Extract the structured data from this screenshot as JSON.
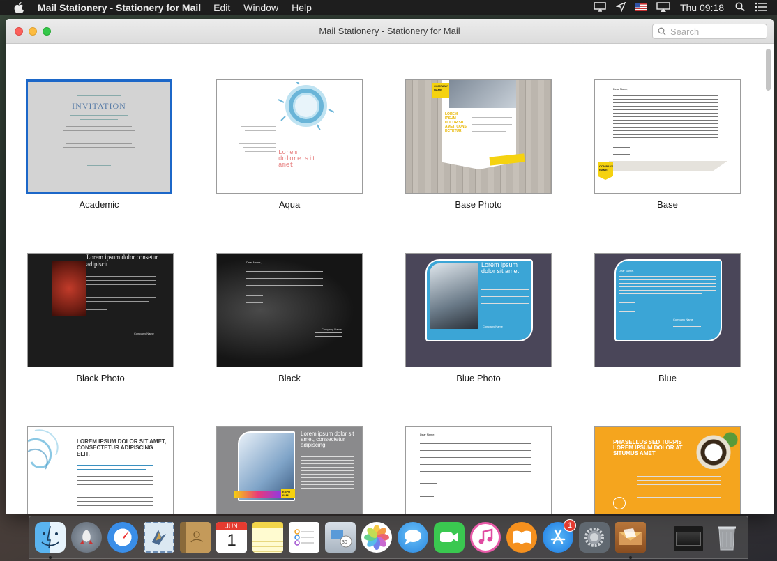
{
  "menubar": {
    "app_name": "Mail Stationery - Stationery for Mail",
    "items": [
      "Edit",
      "Window",
      "Help"
    ],
    "clock": "Thu 09:18"
  },
  "window": {
    "title": "Mail Stationery - Stationery for Mail",
    "search_placeholder": "Search"
  },
  "templates": [
    {
      "label": "Academic",
      "selected": true
    },
    {
      "label": "Aqua",
      "selected": false
    },
    {
      "label": "Base Photo",
      "selected": false
    },
    {
      "label": "Base",
      "selected": false
    },
    {
      "label": "Black Photo",
      "selected": false
    },
    {
      "label": "Black",
      "selected": false
    },
    {
      "label": "Blue Photo",
      "selected": false
    },
    {
      "label": "Blue",
      "selected": false
    },
    {
      "label": "",
      "selected": false
    },
    {
      "label": "",
      "selected": false
    },
    {
      "label": "",
      "selected": false
    },
    {
      "label": "",
      "selected": false
    }
  ],
  "thumb_text": {
    "academic_title": "INVITATION",
    "aqua_heading": "Lorem dolore sit amet",
    "basephoto_badge": "COMPANY NAME",
    "basephoto_heading": "LOREM IPSUM DOLOR SIT AMET, CONS ECTETUR",
    "base_greeting": "Dear Name,",
    "base_badge": "COMPANY NAME",
    "blackphoto_heading": "Lorem ipsum dolor consetur adipiscit",
    "blackphoto_company": "Company Name",
    "black_greeting": "Dear Name,",
    "black_company": "Company Name",
    "bluephoto_heading": "Lorem ipsum dolor sit amet",
    "bluephoto_company": "Company Name",
    "blue_greeting": "Dear Name,",
    "blue_company": "Company Name",
    "row3a_heading": "LOREM IPSUM DOLOR SIT AMET, CONSECTETUR ADIPISCING ELIT.",
    "row3b_heading": "Lorem ipsum dolor sit amet, consectetur adipiscing",
    "row3b_expo": "EXPO 2012",
    "row3c_greeting": "Dear Name,",
    "row3d_heading": "PHASELLUS SED TURPIS LOREM IPSUM DOLOR AT SITUMUS AMET"
  },
  "dock": {
    "calendar_month": "JUN",
    "calendar_day": "1",
    "appstore_badge": "1",
    "apps": [
      "finder",
      "launchpad",
      "safari",
      "mail",
      "contacts",
      "calendar",
      "notes",
      "reminders",
      "photo-booth",
      "photos",
      "messages",
      "facetime",
      "itunes",
      "ibooks",
      "app-store",
      "system-preferences",
      "mail-stationery",
      "minimized-window",
      "trash"
    ]
  },
  "colors": {
    "selection": "#1c67c8",
    "menubar": "#1f1f1f"
  }
}
